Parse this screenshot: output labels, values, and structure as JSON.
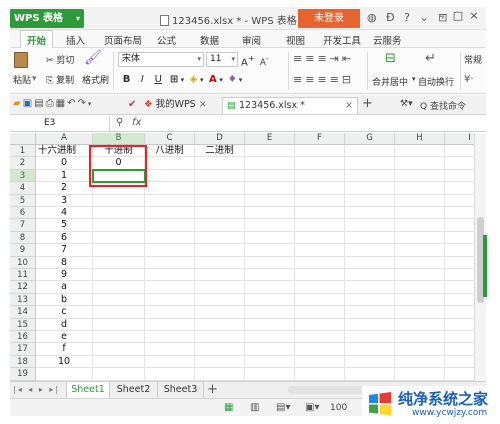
{
  "titlebar": {
    "app_button": "WPS 表格",
    "doc_title": "123456.xlsx * - WPS 表格",
    "login_button": "未登录",
    "icons": [
      "skin-icon",
      "brand-icon",
      "help-icon",
      "minimize-icon"
    ],
    "window_controls": [
      "–",
      "□",
      "×"
    ]
  },
  "menu": {
    "tabs": [
      "开始",
      "插入",
      "页面布局",
      "公式",
      "数据",
      "审阅",
      "视图",
      "开发工具",
      "云服务"
    ]
  },
  "ribbon": {
    "paste": "粘贴",
    "cut": "剪切",
    "copy": "复制",
    "format_painter": "格式刷",
    "font_name": "宋体",
    "font_size": "11",
    "bold": "B",
    "italic": "I",
    "underline": "U",
    "merge_center": "合并居中",
    "wrap_text": "自动换行",
    "number_format": "常规",
    "grow_font": "A",
    "shrink_font": "A"
  },
  "docbar": {
    "tab_mywps": "我的WPS",
    "tab_file": "123456.xlsx *",
    "find_command": "Q 查找命令"
  },
  "formula_bar": {
    "cell_ref": "E3",
    "fx_label": "fx",
    "value": ""
  },
  "grid": {
    "columns": [
      "A",
      "B",
      "C",
      "D",
      "E",
      "F",
      "G",
      "H",
      "I"
    ],
    "rows": [
      "1",
      "2",
      "3",
      "4",
      "5",
      "6",
      "7",
      "8",
      "9",
      "10",
      "11",
      "12",
      "13",
      "14",
      "15",
      "16",
      "17",
      "18",
      "19"
    ],
    "headers": [
      "十六进制",
      "十进制",
      "八进制",
      "二进制"
    ],
    "col_a": [
      "0",
      "1",
      "2",
      "3",
      "4",
      "5",
      "6",
      "7",
      "8",
      "9",
      "a",
      "b",
      "c",
      "d",
      "e",
      "f",
      "10"
    ],
    "b2": "0"
  },
  "sheets": {
    "tabs": [
      "Sheet1",
      "Sheet2",
      "Sheet3"
    ],
    "add": "+"
  },
  "status": {
    "zoom": "100"
  },
  "watermark": {
    "title": "纯净系统之家",
    "url": "www.ycwjzy.com"
  },
  "colors": {
    "accent": "#2e9b3a",
    "login": "#e5642f",
    "highlight": "#e0262a"
  }
}
